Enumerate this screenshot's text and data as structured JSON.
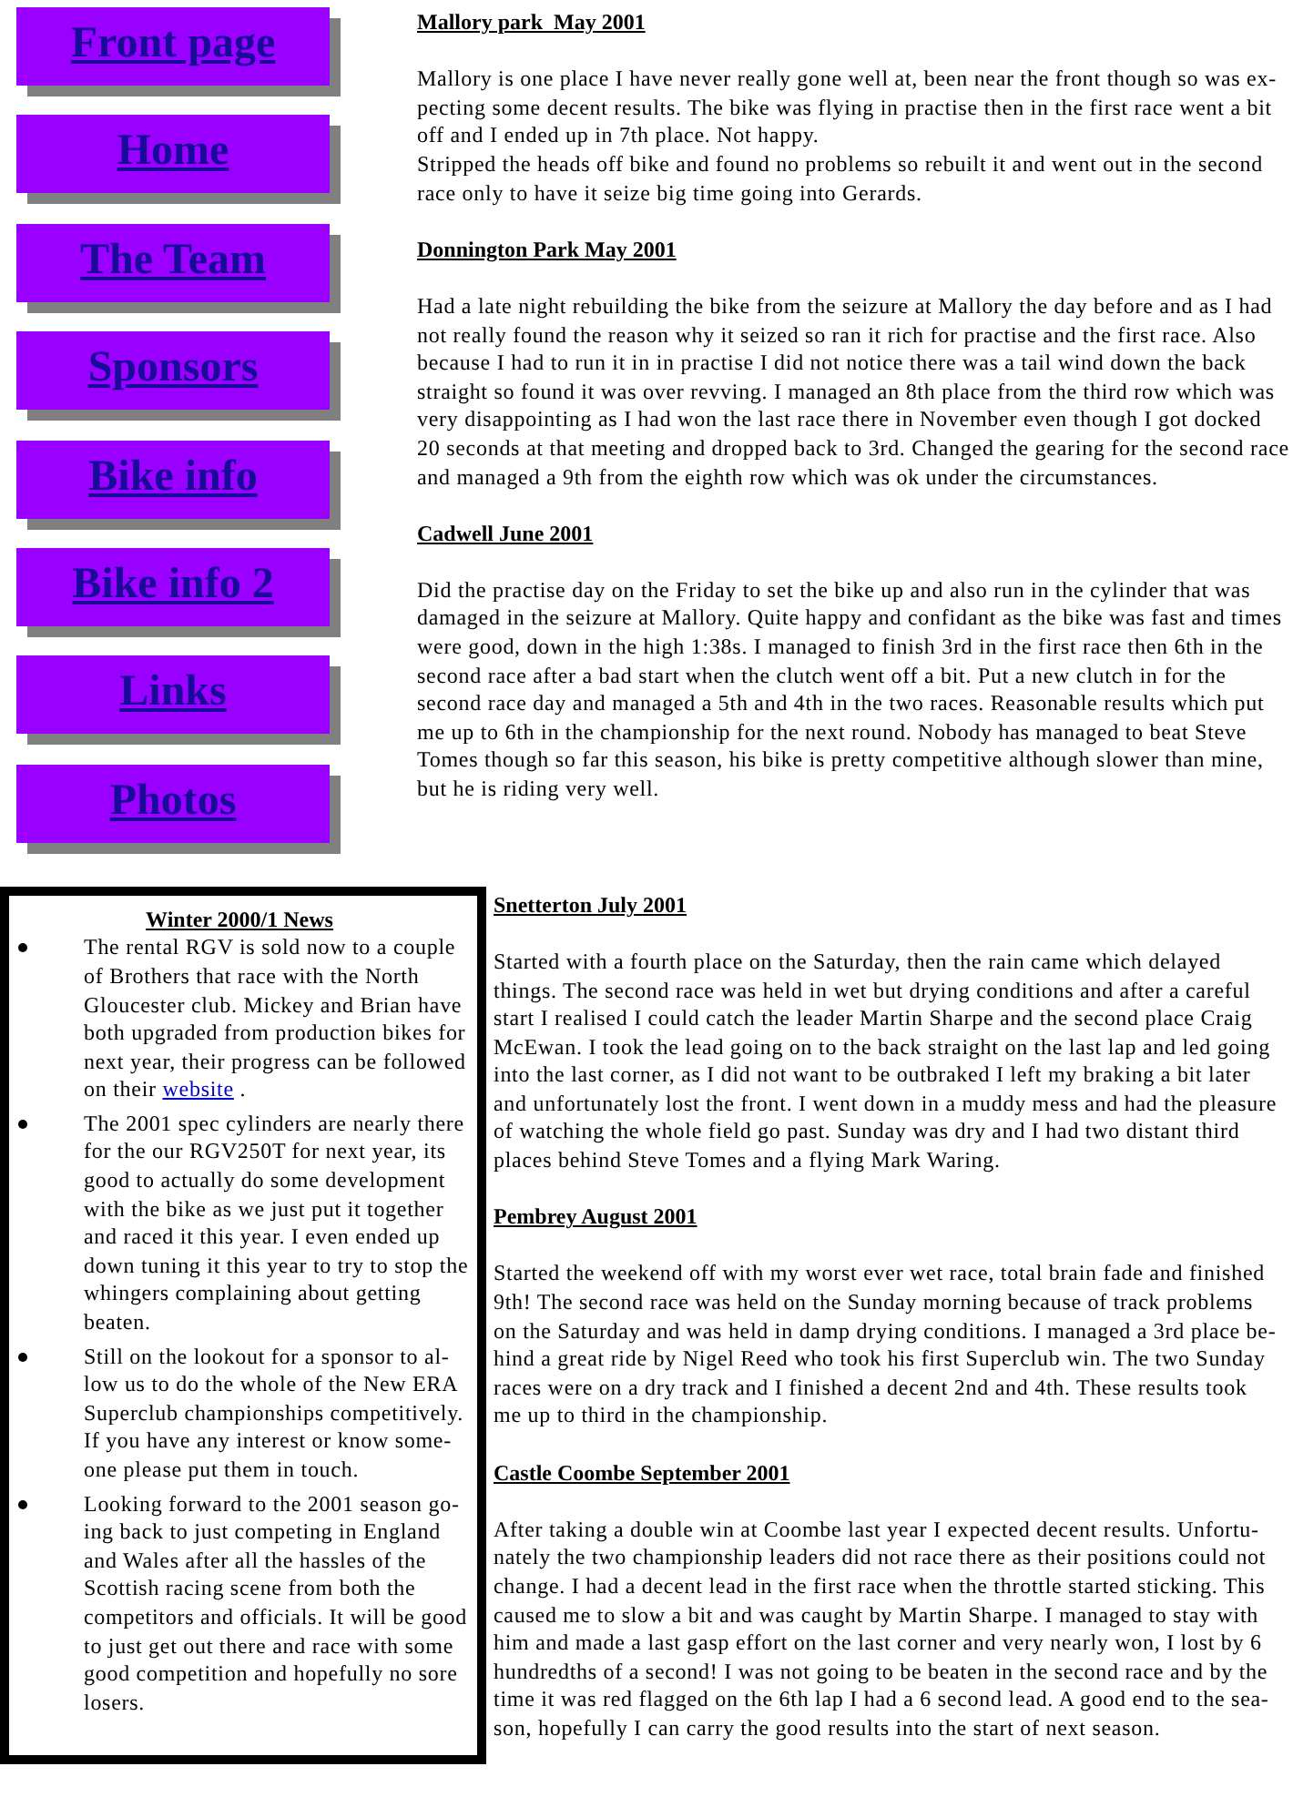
{
  "nav_links": [
    "Front page",
    "Home",
    "The Team",
    "Sponsors",
    "Bike info",
    "Bike info 2",
    "Links",
    "Photos"
  ],
  "upper_reports": [
    {
      "title": "Mallory park  May 2001",
      "paragraphs": [
        [
          "Mallory is one place I have never really gone well at, been near the front though so was ex-pecting some decent results. The bike was flying in practise then in the first race went a bit off and I ended up in 7th place. Not happy.",
          "Stripped the heads off bike and found no problems so rebuilt it and went out in the second race only to have it seize big time going into Gerards."
        ]
      ]
    },
    {
      "title": "Donnington Park May 2001",
      "paragraphs": [
        [
          "Had a late night rebuilding the bike from the seizure at Mallory the day before and as I had not really found the reason why it seized so ran it rich for practise and the first race. Also because I had to run it in in practise I did not notice there was a tail wind down the back straight so found it was over revving. I managed an 8th place from the third row which was very disappointing as I had won the last race there in November even though I got docked 20 seconds at that meeting and dropped back to 3rd. Changed the gearing for the second race and managed a 9th from the eighth row which was ok under the circumstances."
        ]
      ]
    },
    {
      "title": "Cadwell June 2001",
      "paragraphs": [
        [
          "Did the practise day on the Friday to set the bike up and also run in the cylinder that was damaged in the seizure at Mallory. Quite happy and confidant as the bike was fast and times were good, down in the high 1:38s. I managed to finish 3rd in the first race then 6th in the second race after a bad start when the clutch went off a bit. Put a new clutch in for the second race day and managed a 5th and 4th in the two races. Reasonable results which put me up to 6th in the championship for the next round. Nobody has managed to beat Steve Tomes though so far this season, his bike is pretty competitive although slower than mine, but he is riding very well."
        ]
      ]
    }
  ],
  "news_box": {
    "title": "Winter 2000/1 News",
    "items": [
      {
        "text": "The rental RGV is sold now to a couple of Brothers that race with the North Gloucester club. Mickey and Brian have both upgraded from production bikes for next year, their progress can be followed on their",
        "link": "website",
        "after": "."
      },
      {
        "text": "The 2001 spec cylinders are nearly there for the our RGV250T for next year, its good to actually do some development with the bike as we just put it together and raced it this year. I even ended up down tuning it this year to try to stop the whingers complaining about getting beaten."
      },
      {
        "text": "Still on the lookout for a sponsor to al-low us to do the whole of the New ERA Superclub championships competitively. If you have any interest or know some-one please put them in touch."
      },
      {
        "text": "Looking forward to the 2001 season go-ing back to just competing in England and Wales after all the hassles of the Scottish racing scene from both the competitors and officials. It will be good to just get out there and race with some good competition and hopefully no sore losers."
      }
    ]
  },
  "lower_reports": [
    {
      "title": "Snetterton July 2001",
      "paragraphs": [
        [
          "Started with a fourth place on the Saturday, then the rain came which delayed things. The second race was held in wet but drying conditions and after a careful start I realised I could catch the leader Martin Sharpe and the second place Craig McEwan. I took the lead going on to the back straight on the last lap and led going into the last corner, as I did not want to be outbraked I left my braking a bit later and unfortunately lost the front. I went down in a muddy mess and had the pleasure of watching the whole field go past. Sunday was dry and I had two distant third places behind Steve Tomes and a flying Mark Waring."
        ]
      ]
    },
    {
      "title": "Pembrey August 2001",
      "paragraphs": [
        [
          "Started the weekend off with my worst ever wet race, total brain fade and finished 9th! The second race was held on the Sunday morning because of track problems on the Saturday and was held in damp drying conditions. I managed a 3rd place be-hind a great ride by Nigel Reed who took his first Superclub win. The two Sunday races were on a dry track and I finished a decent 2nd and 4th. These results took me up to third in the championship."
        ]
      ]
    },
    {
      "title": "Castle Coombe September 2001",
      "paragraphs": [
        [
          "After taking a double win at Coombe last year I expected decent results. Unfortu-nately the two championship leaders did not race there as their positions could not change. I had a decent lead in the first race when the throttle started sticking. This caused me to slow a bit and was caught by Martin Sharpe. I managed to stay with him and made a last gasp effort on the last corner and very nearly won, I lost by 6 hundredths of a second! I was not going to be beaten in the second race and by the time it was red flagged on the 6th lap I had a 6 second lead. A good end to the sea-son, hopefully I can carry the good results into the start of next season."
        ]
      ]
    }
  ]
}
